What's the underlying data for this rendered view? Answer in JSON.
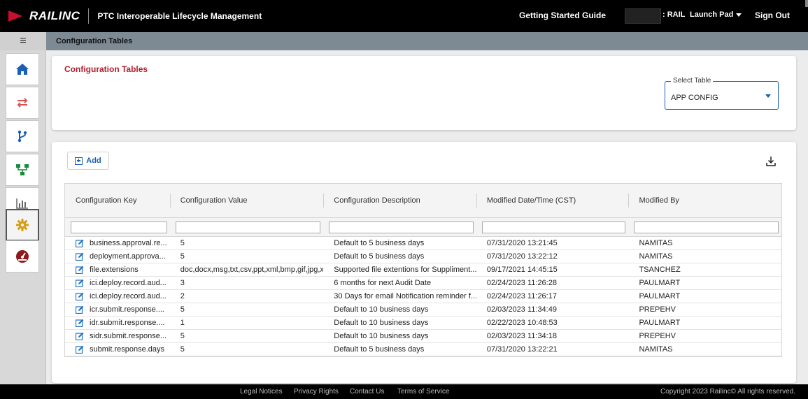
{
  "header": {
    "logo_text": "RAILINC",
    "app_title": "PTC Interoperable Lifecycle Management",
    "getting_started": "Getting Started Guide",
    "rail_label": ": RAIL",
    "launch_pad": "Launch Pad",
    "sign_out": "Sign Out"
  },
  "breadcrumb": {
    "menu_icon": "≡",
    "current": "Configuration Tables"
  },
  "sidebar": {
    "items": [
      {
        "icon": "home-icon",
        "color": "#1a5fb4"
      },
      {
        "icon": "transfer-arrows-icon",
        "color": "#d9534f"
      },
      {
        "icon": "branch-icon",
        "color": "#1a5fb4"
      },
      {
        "icon": "hierarchy-icon",
        "color": "#1a8a3c"
      },
      {
        "icon": "bar-chart-icon",
        "color": "#666666"
      },
      {
        "icon": "gear-icon",
        "color": "#d4a017",
        "active": true
      },
      {
        "icon": "dashboard-gauge-icon",
        "color": "#8b1a1a"
      }
    ]
  },
  "config_card": {
    "title": "Configuration Tables",
    "select_label": "Select Table",
    "select_value": "APP CONFIG"
  },
  "grid": {
    "add_label": "Add",
    "columns": [
      "Configuration Key",
      "Configuration Value",
      "Configuration Description",
      "Modified Date/Time (CST)",
      "Modified By"
    ],
    "rows": [
      {
        "key": "business.approval.re...",
        "value": "5",
        "desc": "Default to 5 business days",
        "modified": "07/31/2020 13:21:45",
        "by": "NAMITAS"
      },
      {
        "key": "deployment.approva...",
        "value": "5",
        "desc": "Default to 5 business days",
        "modified": "07/31/2020 13:22:12",
        "by": "NAMITAS"
      },
      {
        "key": "file.extensions",
        "value": "doc,docx,msg,txt,csv,ppt,xml,bmp,gif,jpg,x...",
        "desc": "Supported file extentions for Suppliment...",
        "modified": "09/17/2021 14:45:15",
        "by": "TSANCHEZ"
      },
      {
        "key": "ici.deploy.record.aud...",
        "value": "3",
        "desc": "6 months for next Audit Date",
        "modified": "02/24/2023 11:26:28",
        "by": "PAULMART"
      },
      {
        "key": "ici.deploy.record.aud...",
        "value": "2",
        "desc": "30 Days for email Notification reminder f...",
        "modified": "02/24/2023 11:26:17",
        "by": "PAULMART"
      },
      {
        "key": "icr.submit.response....",
        "value": "5",
        "desc": "Default to 10 business days",
        "modified": "02/03/2023 11:34:49",
        "by": "PREPEHV"
      },
      {
        "key": "idr.submit.response....",
        "value": "1",
        "desc": "Default to 10 business days",
        "modified": "02/22/2023 10:48:53",
        "by": "PAULMART"
      },
      {
        "key": "sidr.submit.response...",
        "value": "5",
        "desc": "Default to 10 business days",
        "modified": "02/03/2023 11:34:18",
        "by": "PREPEHV"
      },
      {
        "key": "submit.response.days",
        "value": "5",
        "desc": "Default to 5 business days",
        "modified": "07/31/2020 13:22:21",
        "by": "NAMITAS"
      }
    ]
  },
  "footer": {
    "links": [
      "Legal Notices",
      "Privacy Rights",
      "Contact Us",
      "Terms of Service"
    ],
    "copyright": "Copyright 2023 Railinc© All rights reserved."
  }
}
